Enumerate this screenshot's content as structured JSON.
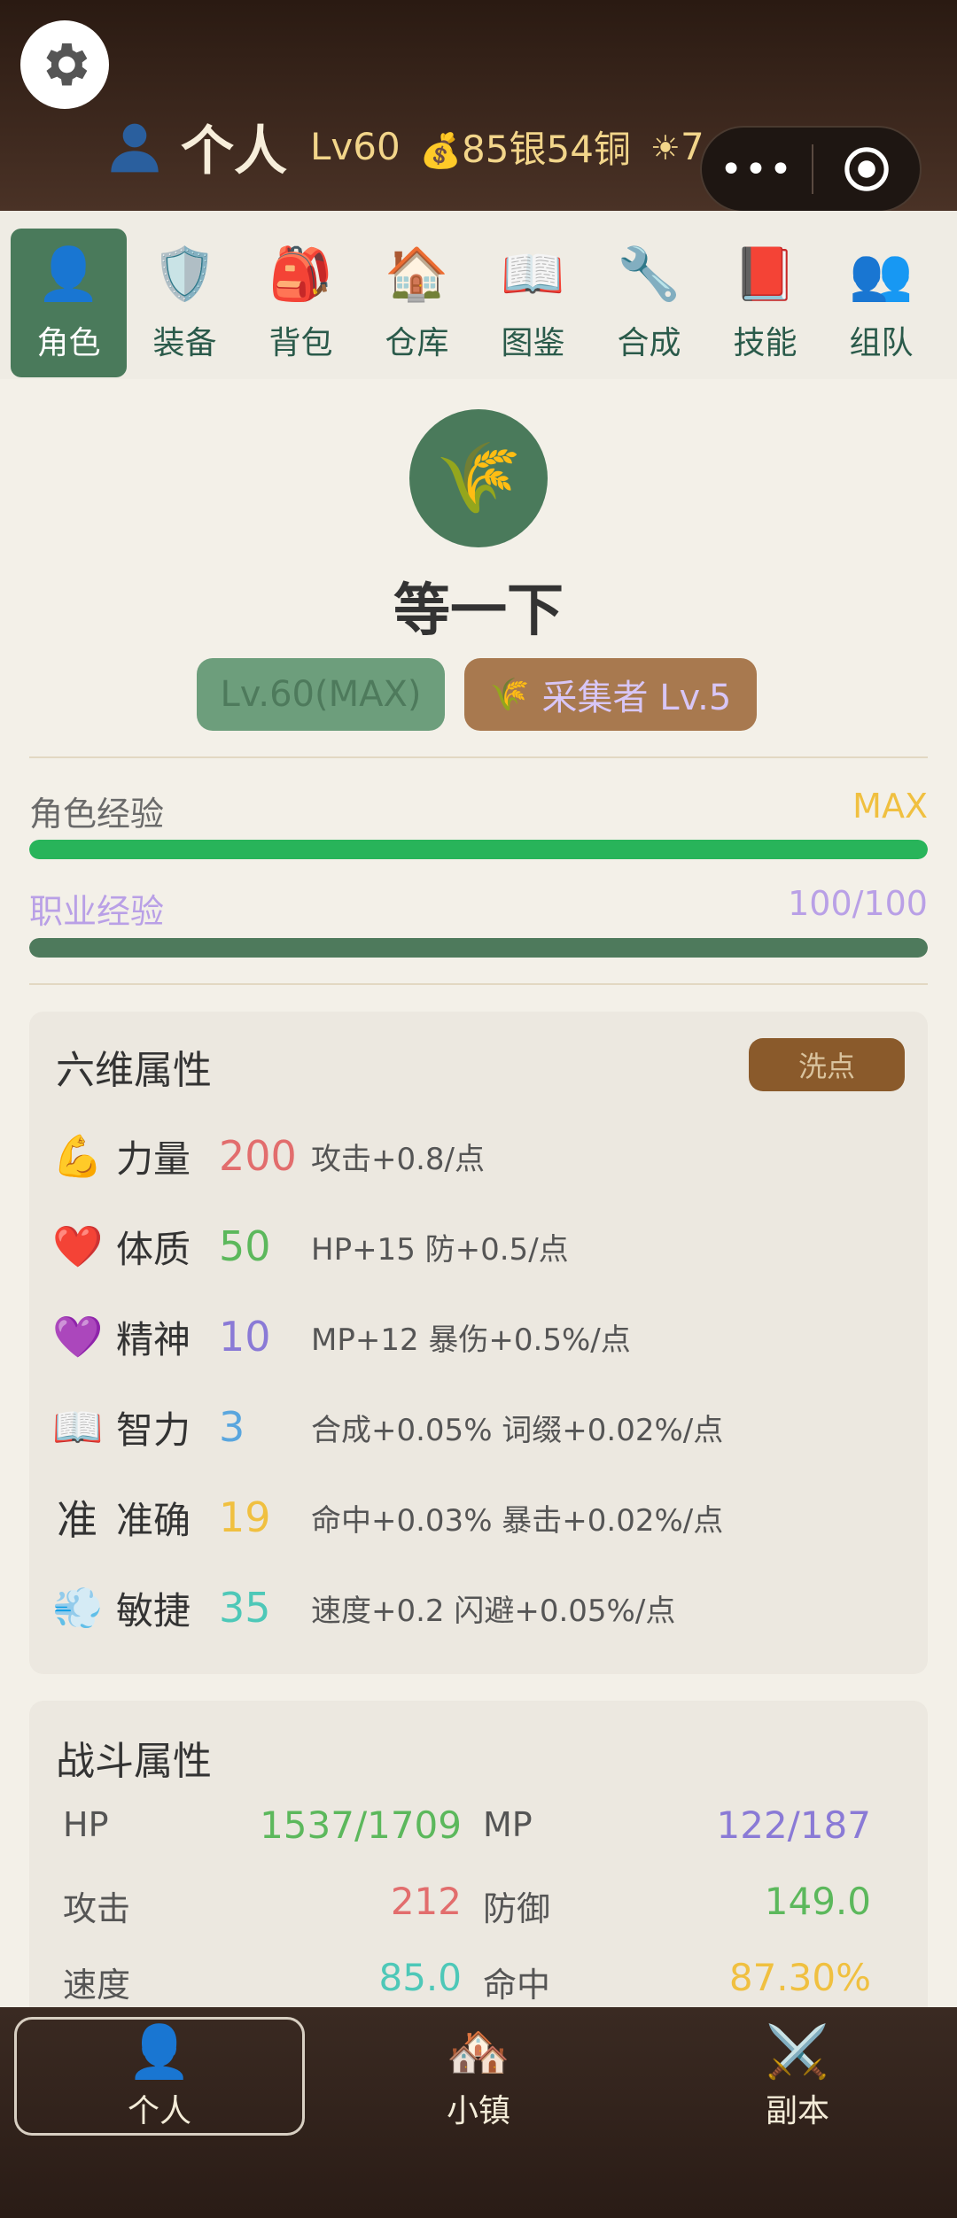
{
  "header": {
    "title": "个人",
    "level": "Lv60",
    "money": "85银54铜",
    "sun_value": "7",
    "settings_icon": "gear-icon",
    "capsule_menu": "•••"
  },
  "tabs": [
    {
      "label": "角色",
      "icon": "👤",
      "active": true
    },
    {
      "label": "装备",
      "icon": "🛡️",
      "active": false
    },
    {
      "label": "背包",
      "icon": "🎒",
      "active": false
    },
    {
      "label": "仓库",
      "icon": "🏠",
      "active": false
    },
    {
      "label": "图鉴",
      "icon": "📖",
      "active": false
    },
    {
      "label": "合成",
      "icon": "🔧",
      "active": false
    },
    {
      "label": "技能",
      "icon": "📕",
      "active": false
    },
    {
      "label": "组队",
      "icon": "👥",
      "active": false
    }
  ],
  "profile": {
    "avatar_icon": "🌾",
    "name": "等一下",
    "level_badge": "Lv.60(MAX)",
    "job_icon": "🌾",
    "job_badge": "采集者 Lv.5"
  },
  "experience": {
    "char_label": "角色经验",
    "char_value": "MAX",
    "char_progress": 1.0,
    "job_label": "职业经验",
    "job_value": "100/100",
    "job_progress": 1.0
  },
  "attributes": {
    "title": "六维属性",
    "reset_label": "洗点",
    "items": [
      {
        "icon": "💪",
        "name": "力量",
        "value": "200",
        "desc": "攻击+0.8/点",
        "color": "#e26d6d"
      },
      {
        "icon": "❤️",
        "name": "体质",
        "value": "50",
        "desc": "HP+15 防+0.5/点",
        "color": "#5cb85c"
      },
      {
        "icon": "💜",
        "name": "精神",
        "value": "10",
        "desc": "MP+12 暴伤+0.5%/点",
        "color": "#8a7ad6"
      },
      {
        "icon": "📖",
        "name": "智力",
        "value": "3",
        "desc": "合成+0.05% 词缀+0.02%/点",
        "color": "#5aa6de"
      },
      {
        "icon": "准",
        "name": "准确",
        "value": "19",
        "desc": "命中+0.03% 暴击+0.02%/点",
        "color": "#f0c040"
      },
      {
        "icon": "💨",
        "name": "敏捷",
        "value": "35",
        "desc": "速度+0.2 闪避+0.05%/点",
        "color": "#4ec8b8"
      }
    ]
  },
  "combat": {
    "title": "战斗属性",
    "stats": [
      {
        "label": "HP",
        "value": "1537/1709",
        "color": "#5cb85c"
      },
      {
        "label": "MP",
        "value": "122/187",
        "color": "#8a7ad6"
      },
      {
        "label": "攻击",
        "value": "212",
        "color": "#e26d6d"
      },
      {
        "label": "防御",
        "value": "149.0",
        "color": "#5cb85c"
      },
      {
        "label": "速度",
        "value": "85.0",
        "color": "#4ec8b8"
      },
      {
        "label": "命中",
        "value": "87.30%",
        "color": "#f0c040"
      }
    ]
  },
  "bottom_nav": [
    {
      "label": "个人",
      "icon": "👤",
      "active": true
    },
    {
      "label": "小镇",
      "icon": "🏘️",
      "active": false
    },
    {
      "label": "副本",
      "icon": "⚔️",
      "active": false
    }
  ]
}
